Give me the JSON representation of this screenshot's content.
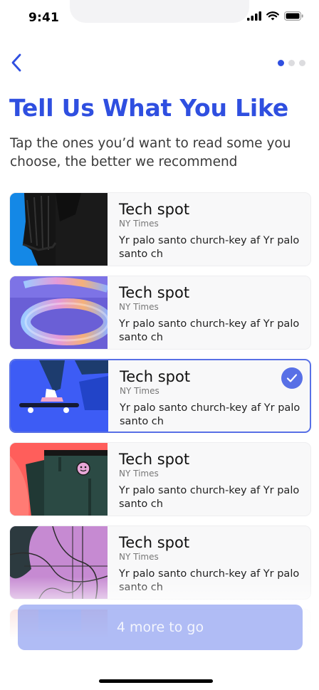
{
  "status_bar": {
    "time": "9:41"
  },
  "header": {
    "title": "Tell Us What You Like",
    "subtitle": "Tap the ones you’d want to read some you choose, the better we recommend"
  },
  "pager": {
    "total": 3,
    "active": 1
  },
  "cards": [
    {
      "title": "Tech spot",
      "source": "NY Times",
      "desc": "Yr palo santo church-key af Yr palo santo ch",
      "selected": false,
      "image": "dark-figure-on-blue"
    },
    {
      "title": "Tech spot",
      "source": "NY Times",
      "desc": "Yr palo santo church-key af Yr palo santo ch",
      "selected": false,
      "image": "iridescent-ring-on-purple"
    },
    {
      "title": "Tech spot",
      "source": "NY Times",
      "desc": "Yr palo santo church-key af Yr palo santo ch",
      "selected": true,
      "image": "skateboard-on-blue"
    },
    {
      "title": "Tech spot",
      "source": "NY Times",
      "desc": "Yr palo santo church-key af Yr palo santo ch",
      "selected": false,
      "image": "smiley-character-on-red"
    },
    {
      "title": "Tech spot",
      "source": "NY Times",
      "desc": "Yr palo santo church-key af Yr palo santo ch",
      "selected": false,
      "image": "abstract-lines-on-pink"
    }
  ],
  "cta": {
    "label": "4 more to go"
  },
  "colors": {
    "accent": "#2f4fe0",
    "selected_border": "#5870e6",
    "cta_bg": "#a5b2f3"
  }
}
